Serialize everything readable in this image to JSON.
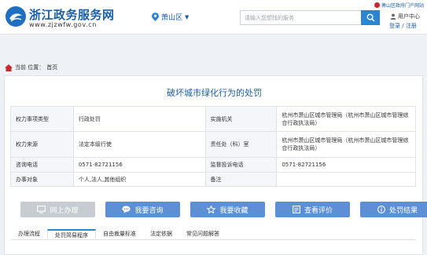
{
  "header": {
    "site_title": "浙江政务服务网",
    "site_url": "www.zjzwfw.gov.cn",
    "region": "萧山区",
    "portal_link": "萧山区政府门户网站",
    "user_center": "用户中心",
    "login": "登录",
    "separator": "/",
    "register": "注册"
  },
  "search": {
    "placeholder": "请输入您想找的服务"
  },
  "breadcrumb": {
    "prefix": "当前 位置：",
    "home": "首页"
  },
  "page": {
    "title": "破坏城市绿化行为的处罚"
  },
  "info_table": {
    "rows": [
      {
        "k1": "权力事项类型",
        "v1": "行政处罚",
        "k2": "实施机关",
        "v2": "杭州市萧山区城市管理局（杭州市萧山区城市管理综合行政执法局）"
      },
      {
        "k1": "权力来源",
        "v1": "法定本级行使",
        "k2": "责任处（科）室",
        "v2": "杭州市萧山区城市管理局（杭州市萧山区城市管理综合行政执法局）"
      },
      {
        "k1": "咨询电话",
        "v1": "0571-82721156",
        "k2": "监督投诉电话",
        "v2": "0571-82721156"
      },
      {
        "k1": "办事对象",
        "v1": "个人,法人,其他组织",
        "k2": "备注",
        "v2": ""
      }
    ]
  },
  "actions": {
    "online": "网上办理",
    "consult": "我要咨询",
    "favorite": "我要收藏",
    "review": "查看评价",
    "result": "处罚结果"
  },
  "tabs": [
    "办理流程",
    "处罚简易程序",
    "自由裁量标准",
    "法定依据",
    "常见问题解答"
  ],
  "colors": {
    "brand": "#1a5ea8",
    "accent_button": "#5c8fd3",
    "disabled_button": "#c7ccd3",
    "search_button": "#2b86d1"
  }
}
